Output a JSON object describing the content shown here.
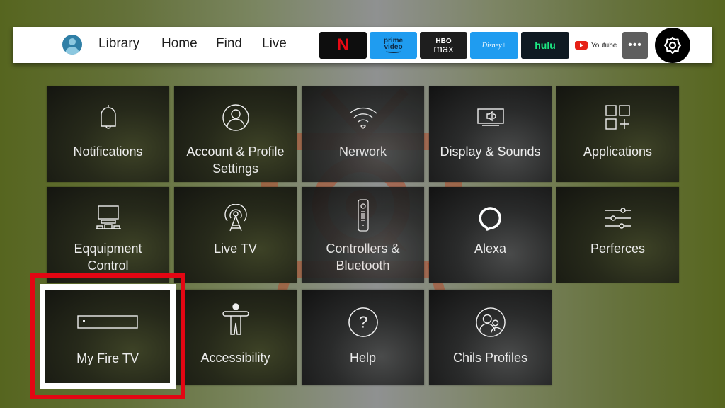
{
  "topbar": {
    "profile_icon": "user-avatar-icon",
    "nav": [
      "Library",
      "Home",
      "Find",
      "Live"
    ],
    "apps": {
      "netflix": "N",
      "prime_line1": "prime",
      "prime_line2": "video",
      "hbo_line1": "HBO",
      "hbo_line2": "max",
      "disney": "Disney+",
      "hulu": "hulu",
      "youtube": "Youtube",
      "more": "•••"
    },
    "settings_icon": "gear-icon"
  },
  "tiles": [
    {
      "label": "Notifications",
      "icon": "bell-icon"
    },
    {
      "label": "Account & Profile Settings",
      "icon": "user-circle-icon"
    },
    {
      "label": "Nerwork",
      "icon": "wifi-icon"
    },
    {
      "label": "Display & Sounds",
      "icon": "tv-speaker-icon"
    },
    {
      "label": "Applications",
      "icon": "apps-grid-icon"
    },
    {
      "label": "Eqquipment Control",
      "icon": "equipment-icon"
    },
    {
      "label": "Live TV",
      "icon": "antenna-icon"
    },
    {
      "label": "Controllers & Bluetooth",
      "icon": "remote-icon"
    },
    {
      "label": "Alexa",
      "icon": "alexa-icon"
    },
    {
      "label": "Perferces",
      "icon": "sliders-icon"
    },
    {
      "label": "My Fire TV",
      "icon": "firetv-device-icon"
    },
    {
      "label": "Accessibility",
      "icon": "accessibility-icon"
    },
    {
      "label": "Help",
      "icon": "help-icon"
    },
    {
      "label": "Chils Profiles",
      "icon": "child-profiles-icon"
    }
  ],
  "focused_tile": "My Fire TV",
  "colors": {
    "highlight_red": "#e30613",
    "focus_white": "#ffffff",
    "watermark": "#b24a2a"
  }
}
